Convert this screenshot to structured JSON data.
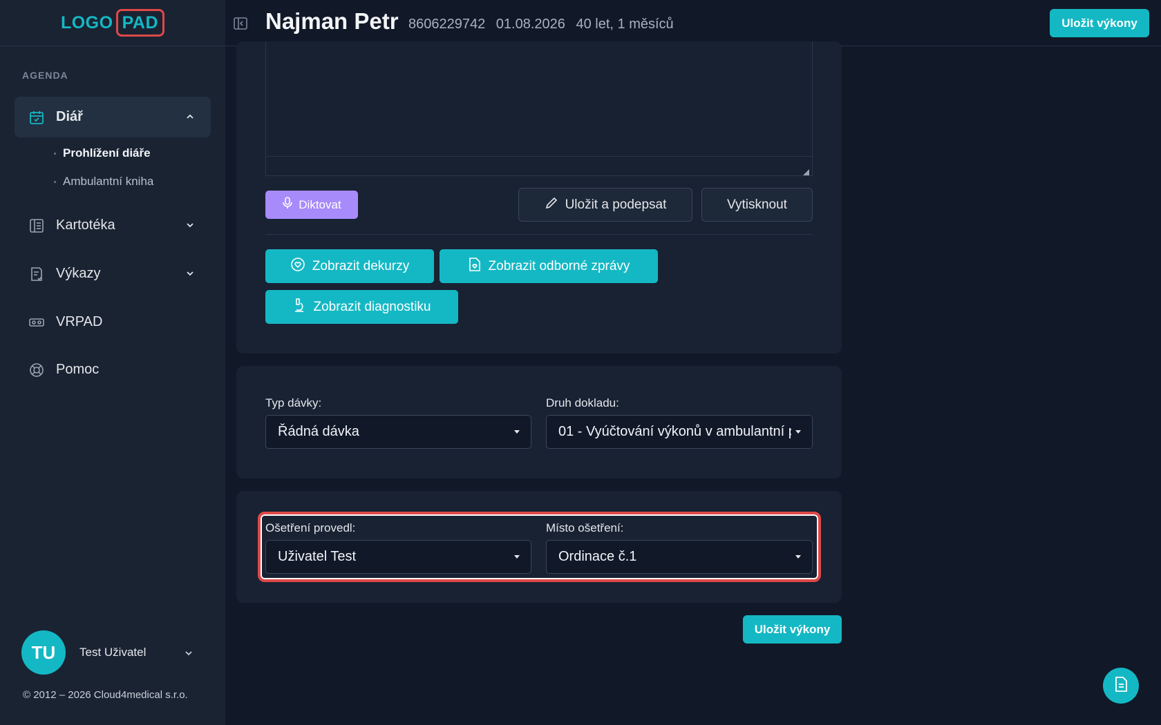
{
  "logo": {
    "part1": "LOGO",
    "part2": "PAD"
  },
  "sidebar": {
    "section_label": "AGENDA",
    "items": [
      {
        "label": "Diář",
        "icon": "calendar-icon"
      },
      {
        "label": "Kartotéka",
        "icon": "card-index-icon"
      },
      {
        "label": "Výkazy",
        "icon": "report-icon"
      },
      {
        "label": "VRPAD",
        "icon": "vr-headset-icon"
      },
      {
        "label": "Pomoc",
        "icon": "lifebuoy-icon"
      }
    ],
    "subitems": [
      {
        "label": "Prohlížení diáře"
      },
      {
        "label": "Ambulantní kniha"
      }
    ],
    "user": {
      "initials": "TU",
      "name": "Test Uživatel"
    },
    "copyright": "© 2012 – 2026 Cloud4medical s.r.o."
  },
  "header": {
    "patient_name": "Najman Petr",
    "birth_number": "8606229742",
    "date": "01.08.2026",
    "age": "40 let, 1 měsíců",
    "save_label": "Uložit výkony"
  },
  "actions": {
    "dictate": "Diktovat",
    "save_sign": "Uložit a podepsat",
    "print": "Vytisknout",
    "show_dekurzy": "Zobrazit dekurzy",
    "show_reports": "Zobrazit odborné zprávy",
    "show_diagnostics": "Zobrazit diagnostiku"
  },
  "batch": {
    "type_label": "Typ dávky:",
    "type_value": "Řádná dávka",
    "doc_label": "Druh dokladu:",
    "doc_value": "01 - Vyúčtování výkonů v ambulantní p"
  },
  "treatment": {
    "by_label": "Ošetření provedl:",
    "by_value": "Uživatel Test",
    "place_label": "Místo ošetření:",
    "place_value": "Ordinace č.1"
  },
  "footer": {
    "save_label": "Uložit výkony"
  },
  "colors": {
    "accent": "#14b8c4",
    "dictate": "#a78bfa",
    "highlight": "#e04848",
    "background": "#111827"
  }
}
